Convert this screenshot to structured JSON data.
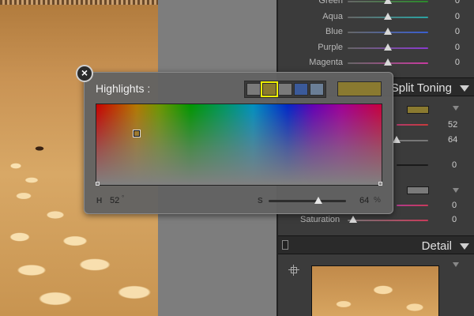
{
  "colors": {
    "highlight_tint": "#8a7a30",
    "shadow_tint": "#7a7a7a"
  },
  "hsl_panel": {
    "rows": [
      {
        "label": "Green",
        "value": "0",
        "gradient": "#2b8a2b"
      },
      {
        "label": "Aqua",
        "value": "0",
        "gradient": "#2aa3a3"
      },
      {
        "label": "Blue",
        "value": "0",
        "gradient": "#3a5fd0"
      },
      {
        "label": "Purple",
        "value": "0",
        "gradient": "#8a3ad0"
      },
      {
        "label": "Magenta",
        "value": "0",
        "gradient": "#c83aa0"
      }
    ]
  },
  "split_toning": {
    "title": "Split Toning",
    "hue_value": "52",
    "saturation_value": "64",
    "balance_value": "0",
    "shadows_hue_value": "0",
    "shadows_saturation_label": "Saturation",
    "shadows_saturation_value": "0"
  },
  "detail": {
    "title": "Detail"
  },
  "popup": {
    "title": "Highlights :",
    "close_label": "×",
    "preset_colors": [
      "#7a7a7a",
      "#8a7a30",
      "#7a7a7a",
      "#3b5a9a",
      "#6a7e96"
    ],
    "selected_preset": 1,
    "h_label": "H",
    "h_value": "52",
    "h_suffix": "°",
    "s_label": "S",
    "s_value": "64",
    "s_suffix": "%",
    "saturation_fraction": 0.64
  }
}
